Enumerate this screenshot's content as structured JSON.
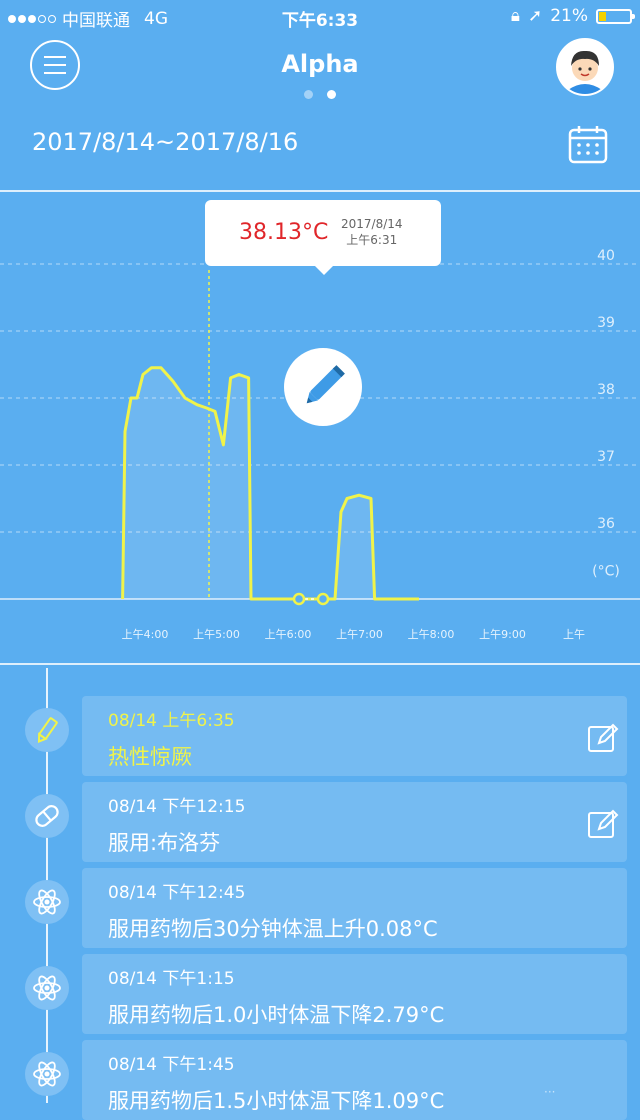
{
  "status": {
    "carrier": "中国联通",
    "network": "4G",
    "time": "下午6:33",
    "battery": "21%",
    "battery_level": 0.21,
    "battery_color": "#f5d100"
  },
  "header": {
    "title": "Alpha",
    "page_dots": 2,
    "active_dot": 1
  },
  "date_range": "2017/8/14~2017/8/16",
  "tooltip": {
    "temp": "38.13°C",
    "date": "2017/8/14",
    "time": "上午6:31"
  },
  "colors": {
    "background": "#5aaef0",
    "line": "#f0f34a",
    "temp_red": "#e0262a"
  },
  "chart_data": {
    "type": "line",
    "y_unit_label": "(°C)",
    "y_ticks": [
      "40",
      "39",
      "38",
      "37",
      "36"
    ],
    "x_ticks": [
      "上午4:00",
      "上午5:00",
      "上午6:00",
      "上午7:00",
      "上午8:00",
      "上午9:00",
      "上午"
    ],
    "ylim": [
      35.0,
      40.5
    ],
    "grid": true,
    "series": [
      {
        "values": [
          [
            "3:48",
            35.0
          ],
          [
            "3:50",
            37.5
          ],
          [
            "3:55",
            38.0
          ],
          [
            "4:00",
            38.0
          ],
          [
            "4:05",
            38.35
          ],
          [
            "4:12",
            38.45
          ],
          [
            "4:20",
            38.45
          ],
          [
            "4:30",
            38.25
          ],
          [
            "4:40",
            38.0
          ],
          [
            "4:50",
            37.9
          ],
          [
            "4:58",
            37.85
          ],
          [
            "5:05",
            37.8
          ],
          [
            "5:12",
            37.3
          ],
          [
            "5:18",
            38.3
          ],
          [
            "5:25",
            38.35
          ],
          [
            "5:33",
            38.3
          ],
          [
            "5:35",
            35.0
          ],
          [
            "6:35",
            35.0
          ],
          [
            "6:45",
            35.0
          ],
          [
            "6:50",
            36.3
          ],
          [
            "6:55",
            36.5
          ],
          [
            "7:05",
            36.55
          ],
          [
            "7:15",
            36.5
          ],
          [
            "7:18",
            35.0
          ],
          [
            "7:55",
            35.0
          ]
        ]
      }
    ],
    "marker_x": "5:00",
    "gap_points": [
      "6:15",
      "6:35"
    ]
  },
  "timeline": [
    {
      "time": "08/14 上午6:35",
      "text": "热性惊厥",
      "icon": "pencil-icon",
      "editable": true,
      "highlight": true
    },
    {
      "time": "08/14 下午12:15",
      "text": "服用:布洛芬",
      "icon": "pill-icon",
      "editable": true,
      "highlight": false
    },
    {
      "time": "08/14 下午12:45",
      "text": "服用药物后30分钟体温上升0.08°C",
      "icon": "atom-icon",
      "editable": false,
      "highlight": false
    },
    {
      "time": "08/14 下午1:15",
      "text": "服用药物后1.0小时体温下降2.79°C",
      "icon": "atom-icon",
      "editable": false,
      "highlight": false
    },
    {
      "time": "08/14 下午1:45",
      "text": "服用药物后1.5小时体温下降1.09°C",
      "icon": "atom-icon",
      "editable": false,
      "highlight": false
    }
  ]
}
